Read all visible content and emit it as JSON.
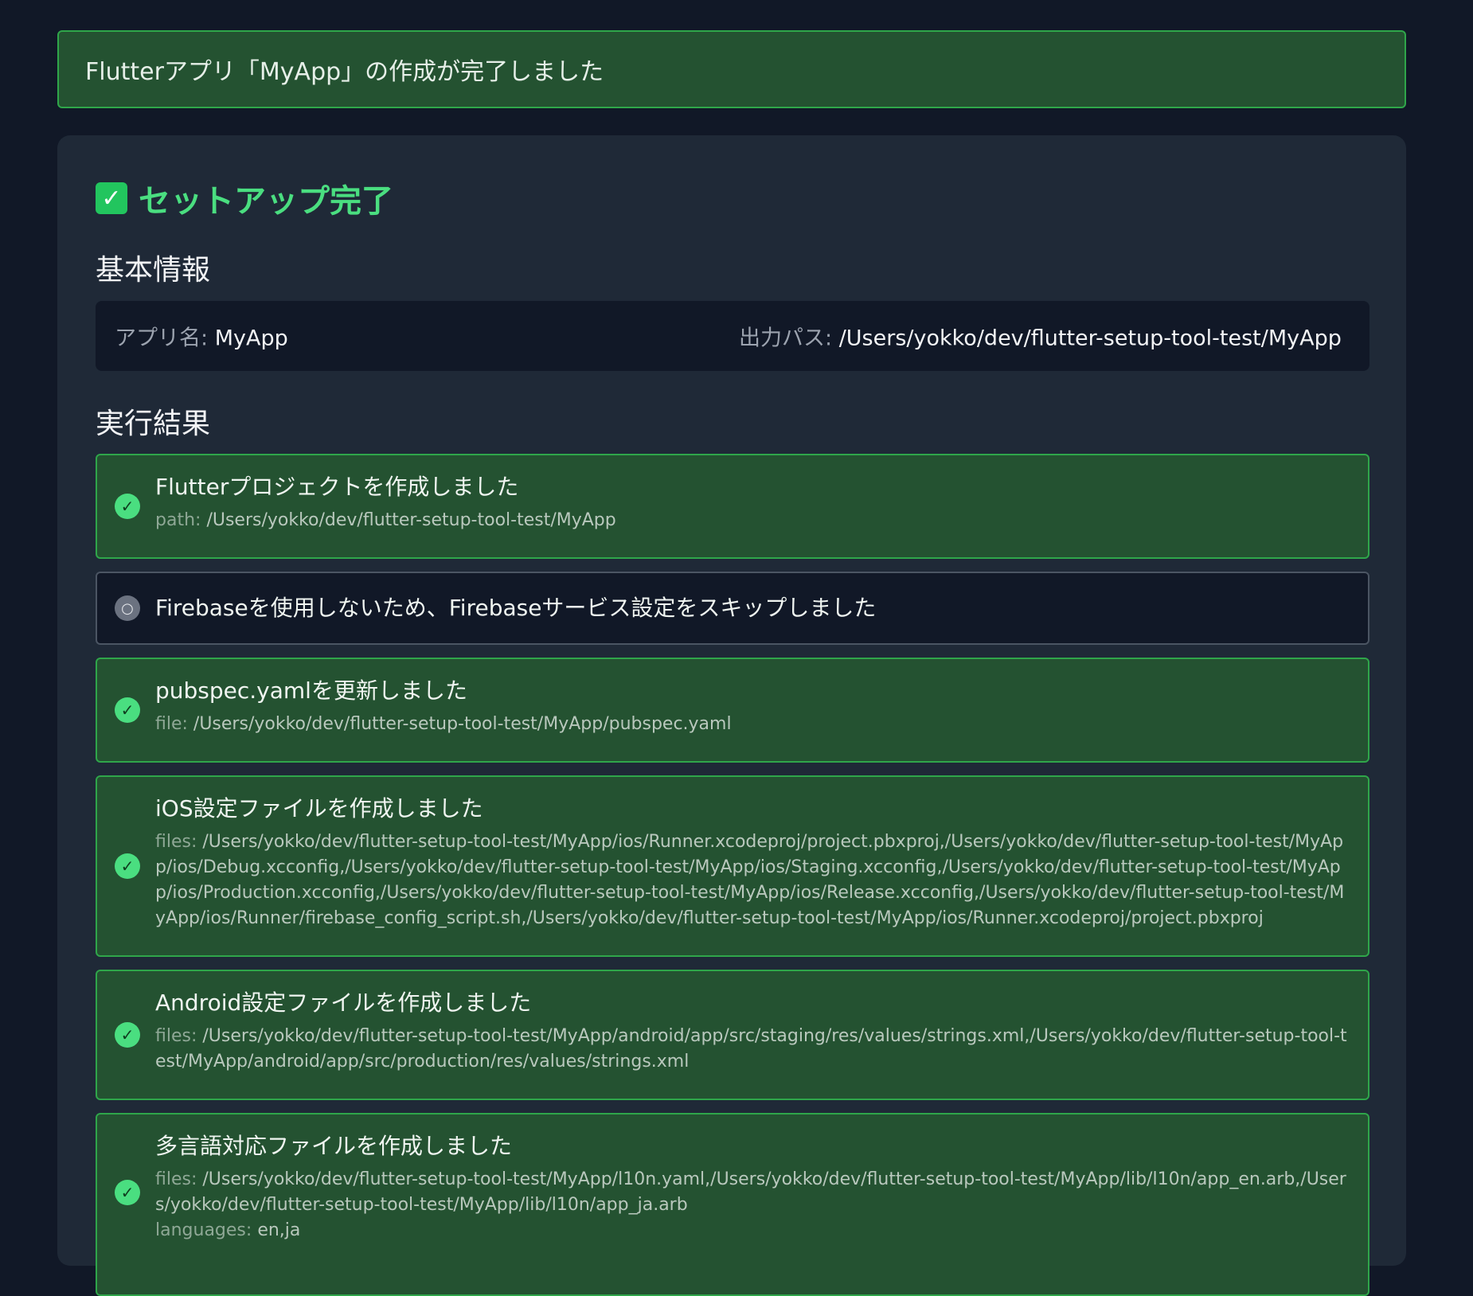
{
  "banner": {
    "message": "Flutterアプリ「MyApp」の作成が完了しました"
  },
  "card": {
    "title": "セットアップ完了",
    "title_icon": "check-mark-button-icon"
  },
  "basic_info": {
    "heading": "基本情報",
    "app_name_label": "アプリ名:",
    "app_name_value": "MyApp",
    "output_path_label": "出力パス:",
    "output_path_value": "/Users/yokko/dev/flutter-setup-tool-test/MyApp"
  },
  "results": {
    "heading": "実行結果",
    "items": [
      {
        "status": "success",
        "icon": "check-circle-icon",
        "title": "Flutterプロジェクトを作成しました",
        "detail_key": "path:",
        "detail_value": "/Users/yokko/dev/flutter-setup-tool-test/MyApp"
      },
      {
        "status": "skipped",
        "icon": "skip-circle-icon",
        "title": "Firebaseを使用しないため、Firebaseサービス設定をスキップしました"
      },
      {
        "status": "success",
        "icon": "check-circle-icon",
        "title": "pubspec.yamlを更新しました",
        "detail_key": "file:",
        "detail_value": "/Users/yokko/dev/flutter-setup-tool-test/MyApp/pubspec.yaml"
      },
      {
        "status": "success",
        "icon": "check-circle-icon",
        "title": "iOS設定ファイルを作成しました",
        "detail_key": "files:",
        "detail_value": "/Users/yokko/dev/flutter-setup-tool-test/MyApp/ios/Runner.xcodeproj/project.pbxproj,/Users/yokko/dev/flutter-setup-tool-test/MyApp/ios/Debug.xcconfig,/Users/yokko/dev/flutter-setup-tool-test/MyApp/ios/Staging.xcconfig,/Users/yokko/dev/flutter-setup-tool-test/MyApp/ios/Production.xcconfig,/Users/yokko/dev/flutter-setup-tool-test/MyApp/ios/Release.xcconfig,/Users/yokko/dev/flutter-setup-tool-test/MyApp/ios/Runner/firebase_config_script.sh,/Users/yokko/dev/flutter-setup-tool-test/MyApp/ios/Runner.xcodeproj/project.pbxproj"
      },
      {
        "status": "success",
        "icon": "check-circle-icon",
        "title": "Android設定ファイルを作成しました",
        "detail_key": "files:",
        "detail_value": "/Users/yokko/dev/flutter-setup-tool-test/MyApp/android/app/src/staging/res/values/strings.xml,/Users/yokko/dev/flutter-setup-tool-test/MyApp/android/app/src/production/res/values/strings.xml"
      },
      {
        "status": "success",
        "icon": "check-circle-icon",
        "title": "多言語対応ファイルを作成しました",
        "detail_key": "files:",
        "detail_value": "/Users/yokko/dev/flutter-setup-tool-test/MyApp/l10n.yaml,/Users/yokko/dev/flutter-setup-tool-test/MyApp/lib/l10n/app_en.arb,/Users/yokko/dev/flutter-setup-tool-test/MyApp/lib/l10n/app_ja.arb",
        "detail2_key": "languages:",
        "detail2_value": "en,ja"
      }
    ]
  },
  "colors": {
    "background": "#111827",
    "card": "#1f2937",
    "success_bg": "#245231",
    "success_border": "#2fa64a",
    "accent_green": "#4ade80",
    "skipped_border": "#4b5563"
  }
}
